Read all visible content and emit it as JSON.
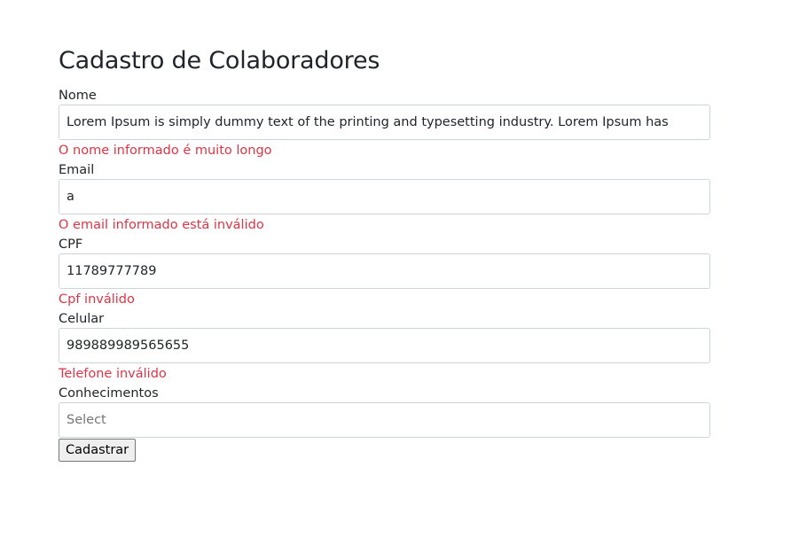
{
  "page": {
    "title": "Cadastro de Colaboradores"
  },
  "form": {
    "nome": {
      "label": "Nome",
      "value": "Lorem Ipsum is simply dummy text of the printing and typesetting industry. Lorem Ipsum has",
      "error": "O nome informado é muito longo"
    },
    "email": {
      "label": "Email",
      "value": "a",
      "error": "O email informado está inválido"
    },
    "cpf": {
      "label": "CPF",
      "value": "11789777789",
      "error": "Cpf inválido"
    },
    "celular": {
      "label": "Celular",
      "value": "989889989565655",
      "error": "Telefone inválido"
    },
    "conhecimentos": {
      "label": "Conhecimentos",
      "placeholder": "Select"
    },
    "submit_label": "Cadastrar"
  },
  "colors": {
    "error": "#dc3545",
    "border": "#ced4da",
    "text": "#212529"
  }
}
